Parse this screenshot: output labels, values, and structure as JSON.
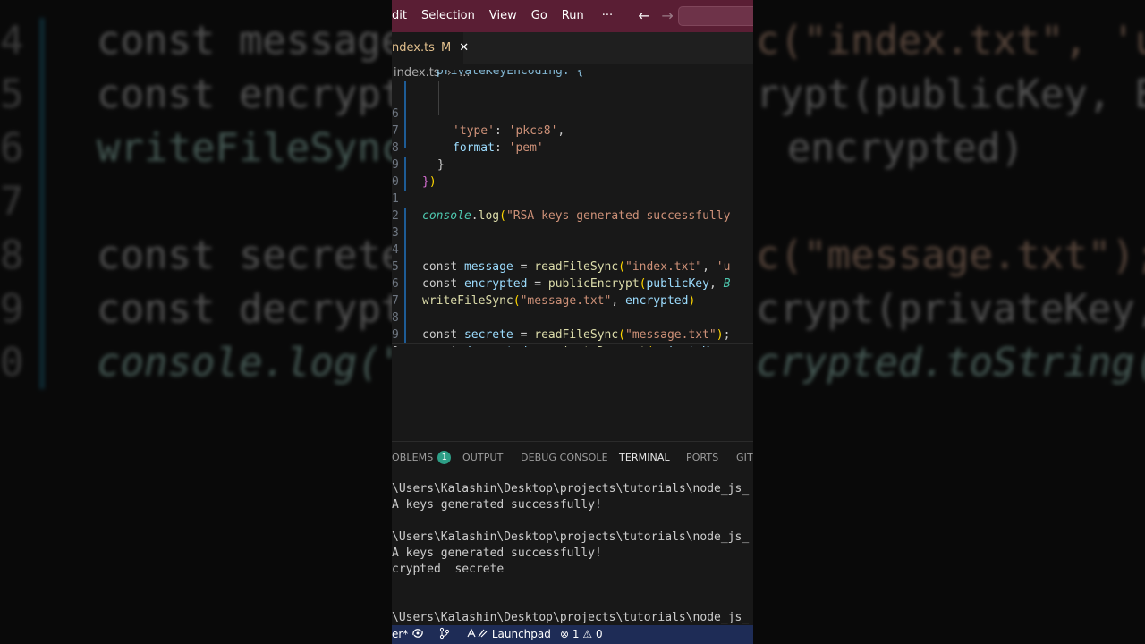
{
  "background": {
    "lines": [
      {
        "ln": "4",
        "code": "const message"
      },
      {
        "ln": "5",
        "code": "const encrypt"
      },
      {
        "ln": "6",
        "code": "writeFileSync"
      },
      {
        "ln": "7",
        "code": ""
      },
      {
        "ln": "8",
        "code": "const secrete"
      },
      {
        "ln": "9",
        "code": "const decrypt"
      },
      {
        "ln": "0",
        "code": "console.log(\""
      }
    ],
    "right_lines": [
      "c(\"index.txt\", 'u",
      "rypt(publicKey, B",
      "encrypted)",
      "",
      "c(\"message.txt\");",
      "crypt(privateKey,",
      "crypted.toString("
    ]
  },
  "titlebar": {
    "menu": [
      "dit",
      "Selection",
      "View",
      "Go",
      "Run",
      "···"
    ],
    "back_arrow": "←",
    "forward_arrow": "→",
    "color": "#5a1e34"
  },
  "tab": {
    "name": "ndex.ts",
    "badge": "M",
    "close": "✕"
  },
  "breadcrumb": {
    "file": "index.ts",
    "sep": "›",
    "more": "..."
  },
  "code": {
    "lines": [
      {
        "ln": "6",
        "text": "'type': 'pkcs8',"
      },
      {
        "ln": "7",
        "text": "format: 'pem'"
      },
      {
        "ln": "8",
        "text": "}"
      },
      {
        "ln": "9",
        "text": "})"
      },
      {
        "ln": "0",
        "text": ""
      },
      {
        "ln": "1",
        "text": "console.log(\"RSA keys generated successfully"
      },
      {
        "ln": "2",
        "text": ""
      },
      {
        "ln": "3",
        "text": ""
      },
      {
        "ln": "4",
        "text": "const message = readFileSync(\"index.txt\", 'u"
      },
      {
        "ln": "5",
        "text": "const encrypted = publicEncrypt(publicKey, B"
      },
      {
        "ln": "6",
        "text": "writeFileSync(\"message.txt\", encrypted)"
      },
      {
        "ln": "7",
        "text": ""
      },
      {
        "ln": "8",
        "text": "const secrete = readFileSync(\"message.txt\");"
      },
      {
        "ln": "9",
        "text": "const decrypted = privateDecrypt(privateKey,"
      },
      {
        "ln": "0",
        "text": "console.log(\"decrypted\", decrypted.toString("
      }
    ]
  },
  "panel": {
    "tabs": [
      "OBLEMS",
      "OUTPUT",
      "DEBUG CONSOLE",
      "TERMINAL",
      "PORTS",
      "GIT"
    ],
    "problems_count": "1",
    "active_tab": "TERMINAL"
  },
  "terminal": {
    "lines": [
      "\\Users\\Kalashin\\Desktop\\projects\\tutorials\\node_js_",
      "A keys generated successfully!",
      "",
      "\\Users\\Kalashin\\Desktop\\projects\\tutorials\\node_js_",
      "A keys generated successfully!",
      "crypted  secrete",
      "",
      "",
      "\\Users\\Kalashin\\Desktop\\projects\\tutorials\\node_js_"
    ]
  },
  "statusbar": {
    "branch": "er*",
    "launchpad": "Launchpad",
    "errors": "1",
    "warnings": "0",
    "color": "#1e2c56"
  }
}
